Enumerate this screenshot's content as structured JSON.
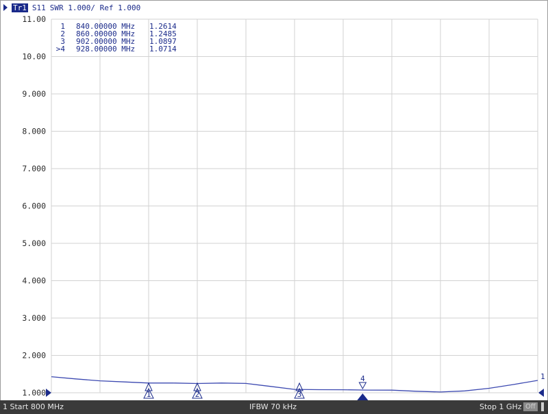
{
  "header": {
    "trace_tag": "Tr1",
    "parameter": "S11",
    "format_text": "SWR 1.000/ Ref 1.000"
  },
  "chart_data": {
    "type": "line",
    "title": "",
    "xlabel": "",
    "ylabel": "",
    "x_unit": "MHz",
    "xlim": [
      800,
      1000
    ],
    "ylim": [
      1.0,
      11.0
    ],
    "y_tick_labels": [
      "11.00",
      "10.00",
      "9.000",
      "8.000",
      "7.000",
      "6.000",
      "5.000",
      "4.000",
      "3.000",
      "2.000",
      "1.000"
    ],
    "grid": true,
    "series": [
      {
        "x": [
          800,
          810,
          820,
          830,
          840,
          850,
          860,
          870,
          880,
          890,
          900,
          910,
          920,
          930,
          940,
          950,
          960,
          970,
          980,
          990,
          1000
        ],
        "y": [
          1.43,
          1.37,
          1.32,
          1.29,
          1.2614,
          1.26,
          1.2485,
          1.26,
          1.25,
          1.17,
          1.09,
          1.083,
          1.08,
          1.071,
          1.07,
          1.04,
          1.02,
          1.05,
          1.12,
          1.22,
          1.33
        ]
      }
    ],
    "markers": [
      {
        "id": "1",
        "list_prefix": "1",
        "x": 840,
        "freq": "840.00000 MHz",
        "value": "1.2614",
        "active": false
      },
      {
        "id": "2",
        "list_prefix": "2",
        "x": 860,
        "freq": "860.00000 MHz",
        "value": "1.2485",
        "active": false
      },
      {
        "id": "3",
        "list_prefix": "3",
        "x": 902,
        "freq": "902.00000 MHz",
        "value": "1.0897",
        "active": false
      },
      {
        "id": "4",
        "list_prefix": ">4",
        "x": 928,
        "freq": "928.00000 MHz",
        "value": "1.0714",
        "active": true
      }
    ],
    "trace_end_label": "1"
  },
  "status": {
    "start": "1 Start 800 MHz",
    "ifbw": "IFBW 70 kHz",
    "stop": "Stop 1 GHz",
    "off_label": "Off"
  },
  "colors": {
    "trace": "#3b48b0",
    "marker": "#1a2a8a",
    "grid": "#d2d2d2",
    "status_bg": "#3a3a3a"
  }
}
